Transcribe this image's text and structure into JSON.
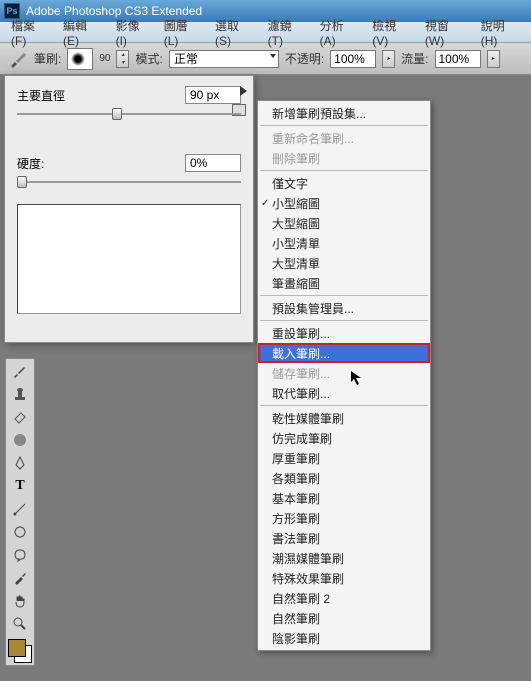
{
  "window": {
    "title": "Adobe Photoshop CS3 Extended"
  },
  "menubar": [
    "檔案(F)",
    "編輯(E)",
    "影像(I)",
    "圖層(L)",
    "選取(S)",
    "濾鏡(T)",
    "分析(A)",
    "檢視(V)",
    "視窗(W)",
    "說明(H)"
  ],
  "optionsbar": {
    "brush_label": "筆刷:",
    "brush_size": "90",
    "mode_label": "模式:",
    "mode_value": "正常",
    "opacity_label": "不透明:",
    "opacity_value": "100%",
    "flow_label": "流量:",
    "flow_value": "100%"
  },
  "brush_panel": {
    "diameter_label": "主要直徑",
    "diameter_value": "90 px",
    "hardness_label": "硬度:",
    "hardness_value": "0%"
  },
  "context_menu": {
    "groups": [
      [
        {
          "label": "新增筆刷預設集...",
          "state": "n"
        }
      ],
      [
        {
          "label": "重新命名筆刷...",
          "state": "d"
        },
        {
          "label": "刪除筆刷",
          "state": "d"
        }
      ],
      [
        {
          "label": "僅文字",
          "state": "n"
        },
        {
          "label": "小型縮圖",
          "state": "c"
        },
        {
          "label": "大型縮圖",
          "state": "n"
        },
        {
          "label": "小型清單",
          "state": "n"
        },
        {
          "label": "大型清單",
          "state": "n"
        },
        {
          "label": "筆畫縮圖",
          "state": "n"
        }
      ],
      [
        {
          "label": "預設集管理員...",
          "state": "n"
        }
      ],
      [
        {
          "label": "重設筆刷...",
          "state": "n"
        },
        {
          "label": "載入筆刷...",
          "state": "h"
        },
        {
          "label": "儲存筆刷...",
          "state": "d"
        },
        {
          "label": "取代筆刷...",
          "state": "n"
        }
      ],
      [
        {
          "label": "乾性媒體筆刷",
          "state": "n"
        },
        {
          "label": "仿完成筆刷",
          "state": "n"
        },
        {
          "label": "厚重筆刷",
          "state": "n"
        },
        {
          "label": "各類筆刷",
          "state": "n"
        },
        {
          "label": "基本筆刷",
          "state": "n"
        },
        {
          "label": "方形筆刷",
          "state": "n"
        },
        {
          "label": "書法筆刷",
          "state": "n"
        },
        {
          "label": "潮濕媒體筆刷",
          "state": "n"
        },
        {
          "label": "特殊效果筆刷",
          "state": "n"
        },
        {
          "label": "自然筆刷 2",
          "state": "n"
        },
        {
          "label": "自然筆刷",
          "state": "n"
        },
        {
          "label": "陰影筆刷",
          "state": "n"
        }
      ]
    ]
  }
}
